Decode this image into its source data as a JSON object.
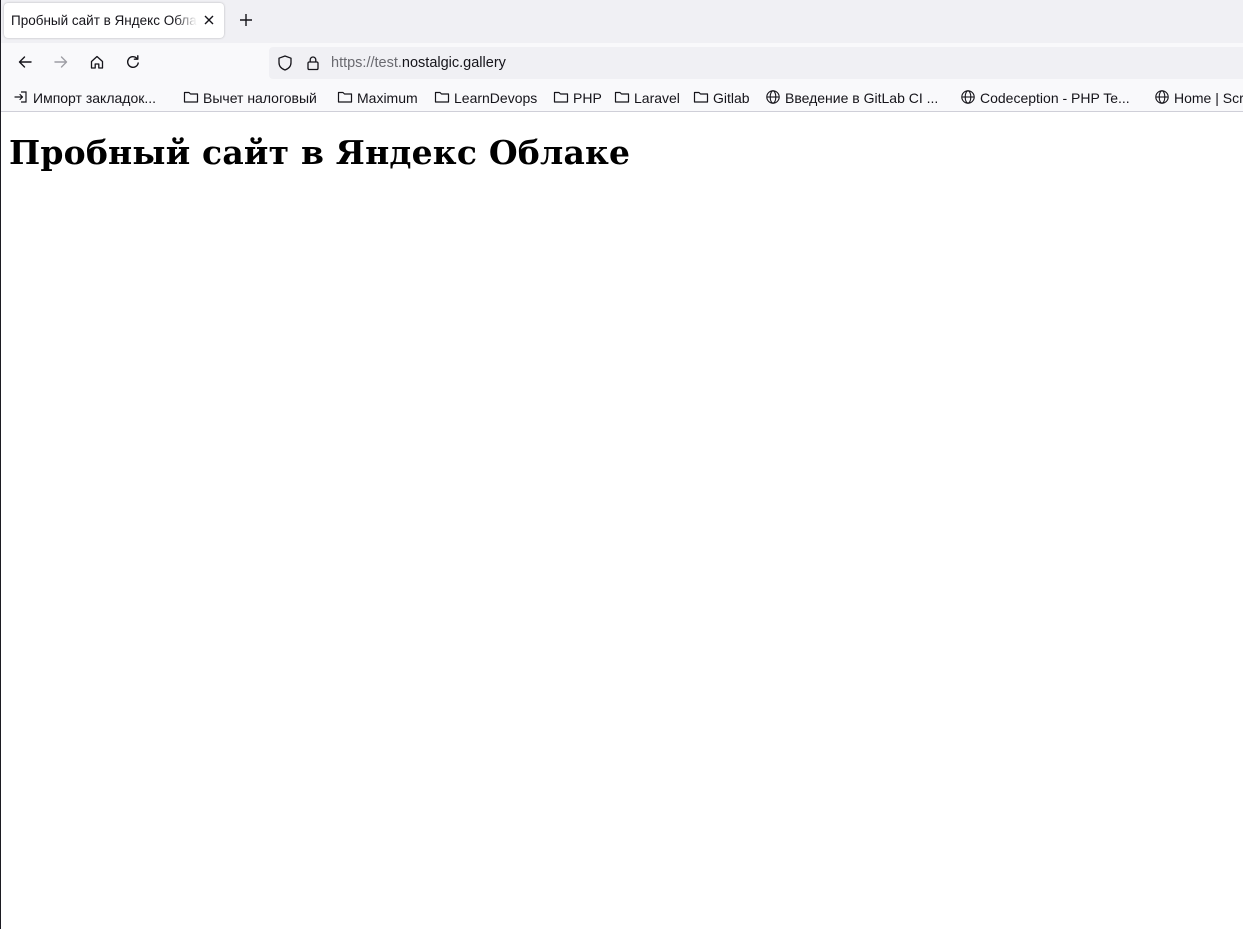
{
  "browser": {
    "tab": {
      "title": "Пробный сайт в Яндекс Облаке",
      "close_icon": "close-icon"
    },
    "new_tab_icon": "plus-icon",
    "nav": {
      "back_icon": "arrow-left-icon",
      "forward_icon": "arrow-right-icon",
      "home_icon": "home-icon",
      "reload_icon": "reload-icon"
    },
    "url": {
      "scheme_prefix": "https://test.",
      "domain": "nostalgic.gallery"
    },
    "bookmarks": [
      {
        "label": "Импорт закладок...",
        "icon": "import-icon"
      },
      {
        "label": "Вычет налоговый",
        "icon": "folder-icon"
      },
      {
        "label": "Maximum",
        "icon": "folder-icon"
      },
      {
        "label": "LearnDevops",
        "icon": "folder-icon"
      },
      {
        "label": "PHP",
        "icon": "folder-icon"
      },
      {
        "label": "Laravel",
        "icon": "folder-icon"
      },
      {
        "label": "Gitlab",
        "icon": "folder-icon"
      },
      {
        "label": "Введение в GitLab CI ...",
        "icon": "globe-icon"
      },
      {
        "label": "Codeception - PHP Te...",
        "icon": "globe-icon"
      },
      {
        "label": "Home | Scr",
        "icon": "globe-icon"
      }
    ]
  },
  "page": {
    "heading": "Пробный сайт в Яндекс Облаке"
  },
  "colors": {
    "tabbar_bg": "#f0f0f4",
    "toolbar_bg": "#f9f9fb",
    "text": "#15141a",
    "muted": "#6a6a70"
  }
}
